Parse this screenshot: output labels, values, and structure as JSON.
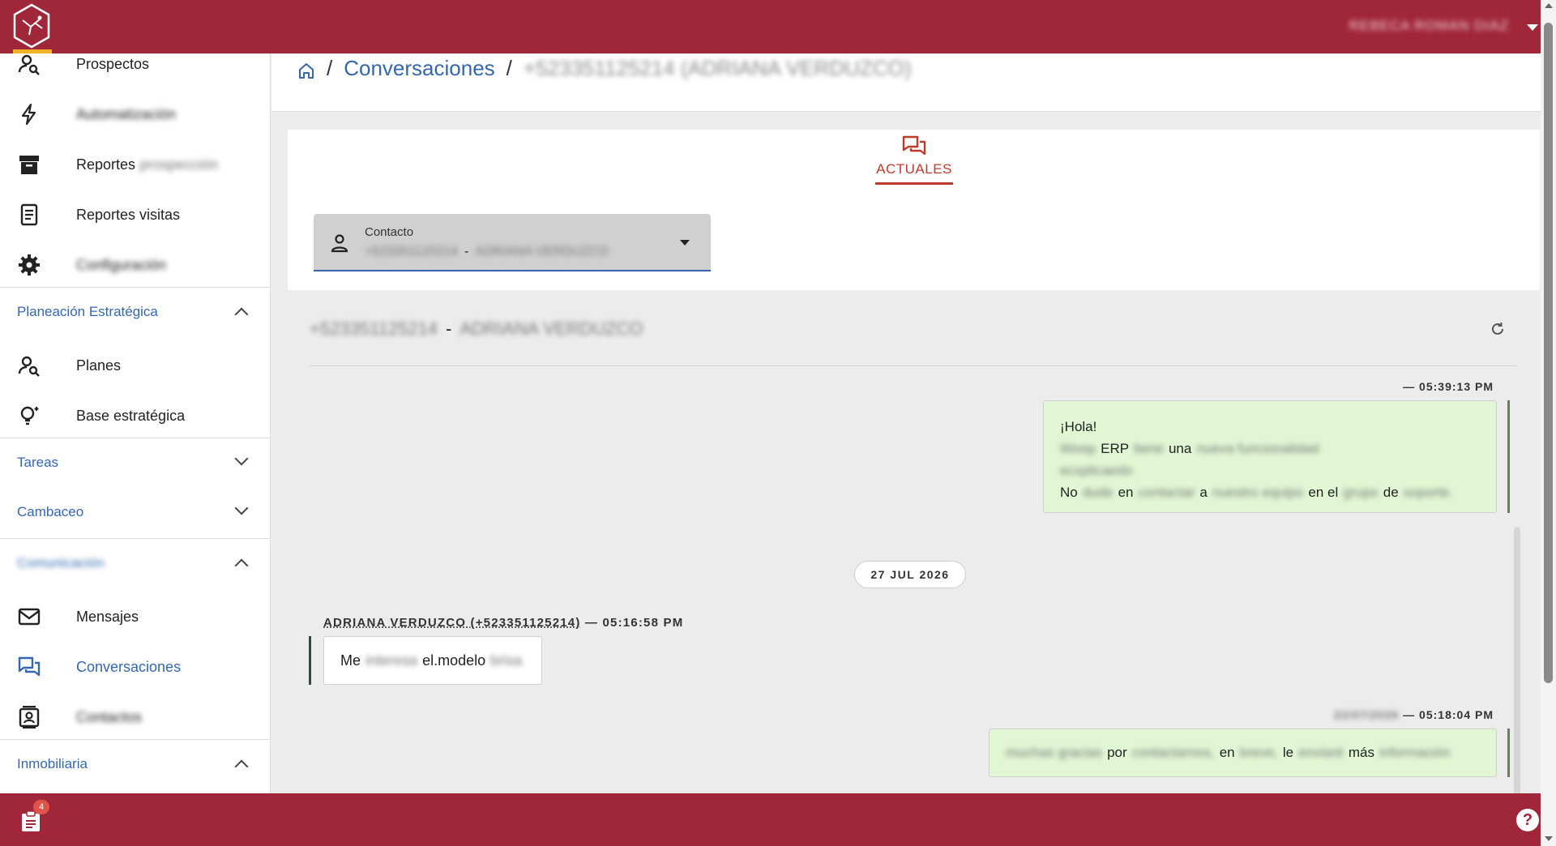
{
  "header": {
    "user_name": "REBECA ROMAN DIAZ"
  },
  "sidebar": {
    "items": [
      {
        "label": "Prospectos",
        "blurred": ""
      },
      {
        "label": "",
        "blurred": "Automatización"
      },
      {
        "label": "Reportes",
        "blurred": "prospección"
      },
      {
        "label": "Reportes visitas",
        "blurred": ""
      },
      {
        "label": "",
        "blurred": "Configuración"
      }
    ],
    "section_planeacion": "Planeación Estratégica",
    "planeacion_items": [
      "Planes",
      "Base estratégica"
    ],
    "section_tareas": "Tareas",
    "section_cambaceo": "Cambaceo",
    "section_comunicacion": "Comunicación",
    "comunicacion_items": [
      "Mensajes",
      "Conversaciones",
      "Contactos"
    ],
    "section_inmobiliaria": "Inmobiliaria"
  },
  "breadcrumb": {
    "link": "Conversaciones",
    "current": "+523351125214 (ADRIANA VERDUZCO)"
  },
  "tabs": {
    "actuales": "ACTUALES"
  },
  "contact_field": {
    "label": "Contacto",
    "phone": "+523351125214",
    "dash": "-",
    "name": "ADRIANA VERDUZCO"
  },
  "chat": {
    "header_phone": "+523351125214",
    "header_dash": "-",
    "header_name": "ADRIANA VERDUZCO",
    "msg1": {
      "meta": "— 05:39:13 PM",
      "line1": "¡Hola!",
      "line2_a": "Woop",
      "line2_b": "ERP",
      "line2_c": "tiene",
      "line2_d": "una",
      "line2_e": "nueva funcionalidad",
      "line3": "ecxplicaedo",
      "line4_a": "No",
      "line4_b": "dude",
      "line4_c": "en",
      "line4_d": "contactar",
      "line4_e": "a",
      "line4_f": "nuestro equipo",
      "line4_g": "en el",
      "line4_h": "grupo",
      "line4_i": "de",
      "line4_j": "soporte."
    },
    "date_separator": "27 JUL 2026",
    "msg2": {
      "sender": "ADRIANA VERDUZCO (+523351125214)",
      "time": "— 05:16:58 PM",
      "a": "Me",
      "b": "interesa",
      "c": "el.modelo",
      "d": "brisa"
    },
    "msg3": {
      "meta_blur": "22/07/2026",
      "time": "— 05:18:04 PM",
      "a": "muchas gracias",
      "b": "por",
      "c": "contactarnos,",
      "d": "en",
      "e": "breve,",
      "f": "le",
      "g": "enviaré",
      "h": "más",
      "i": "información"
    }
  },
  "bottom": {
    "tasks_count": "4",
    "help": "?"
  }
}
